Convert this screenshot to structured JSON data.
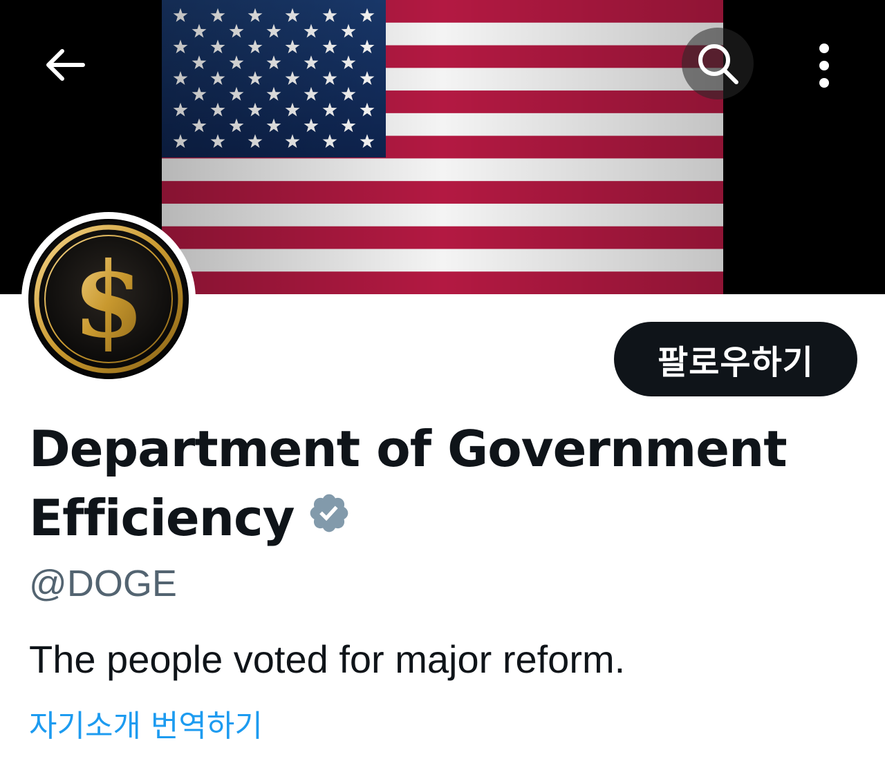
{
  "header": {
    "back_icon": "arrow-left-icon",
    "search_icon": "search-icon",
    "more_icon": "more-vertical-icon"
  },
  "banner": {
    "image": "american-flag"
  },
  "avatar": {
    "image": "gold-dollar-coin"
  },
  "profile": {
    "follow_label": "팔로우하기",
    "display_name": "Department of Government Efficiency",
    "verified_icon": "verified-badge-icon",
    "handle": "@DOGE",
    "bio": "The people voted for major reform.",
    "translate_bio": "자기소개 번역하기"
  },
  "colors": {
    "primary_text": "#0f1419",
    "secondary_text": "#536471",
    "link": "#1d9bf0",
    "verified_badge": "#829aab",
    "follow_button_bg": "#0f1419"
  }
}
